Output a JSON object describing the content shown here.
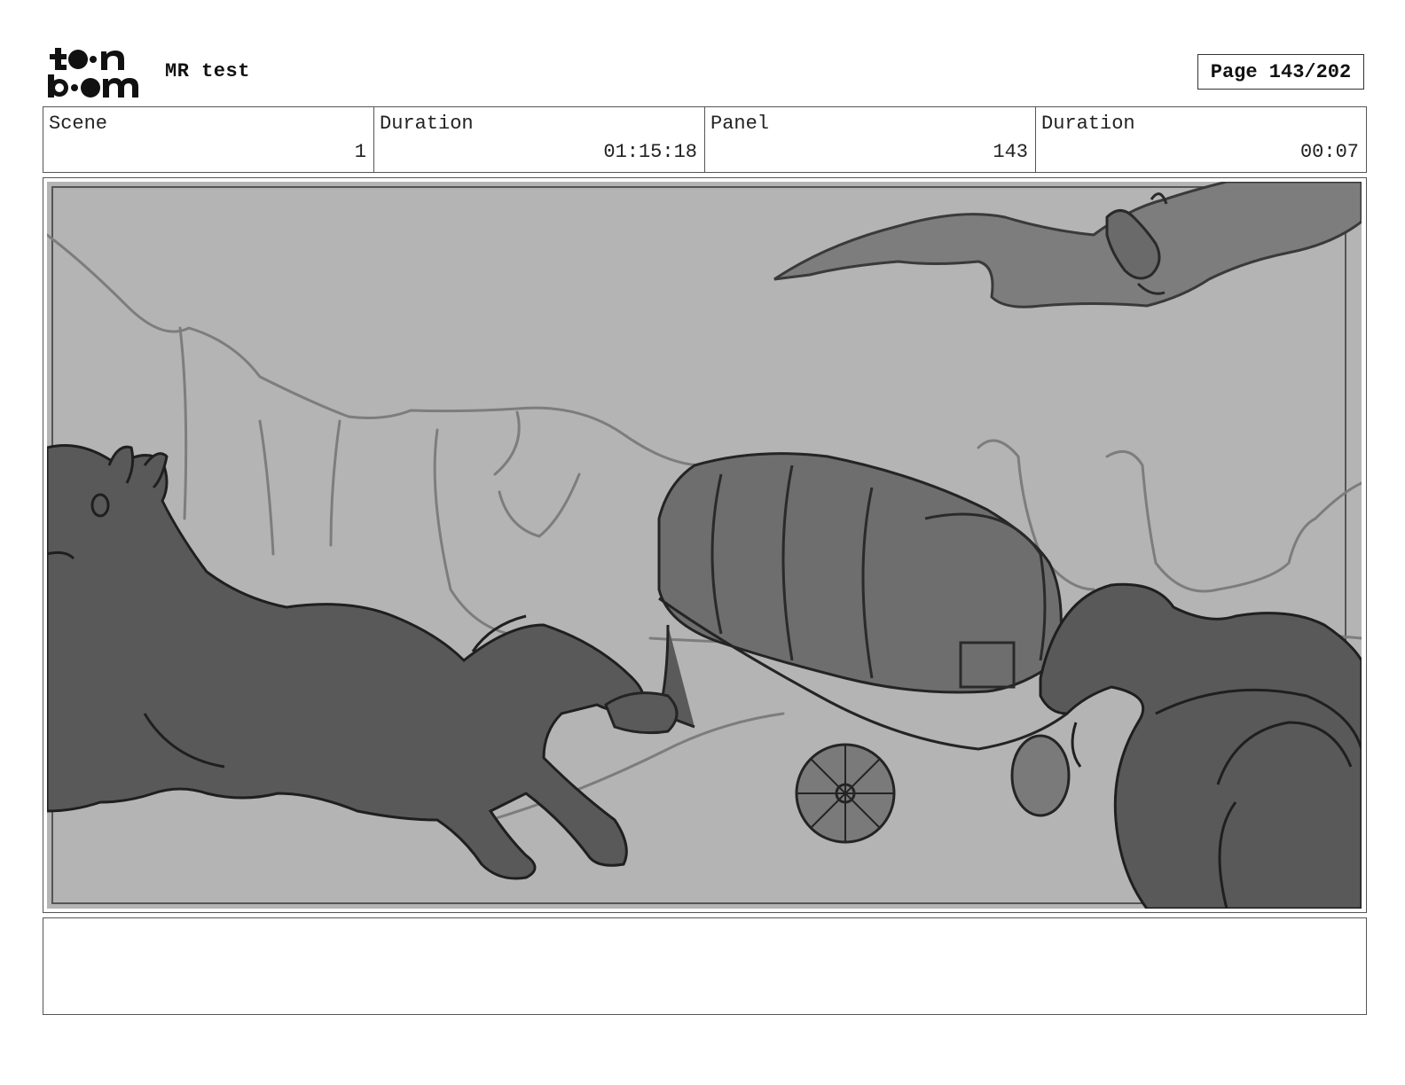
{
  "header": {
    "logo_name": "toonboom-logo",
    "title": "MR test",
    "page_label": "Page 143/202"
  },
  "info": {
    "scene_label": "Scene",
    "scene_value": "1",
    "scene_duration_label": "Duration",
    "scene_duration_value": "01:15:18",
    "panel_label": "Panel",
    "panel_value": "143",
    "panel_duration_label": "Duration",
    "panel_duration_value": "00:07"
  },
  "panel": {
    "image_description_icons": [
      "horse-sketch",
      "wagon-sketch",
      "flying-creature-sketch",
      "canyon-sketch"
    ],
    "colors": {
      "sky": "#b4b4b4",
      "ground": "#b9b9b9",
      "dark_fill": "#5a5a5a",
      "mid_fill": "#6e6e6e",
      "line": "#2a2a2a",
      "sketch_line": "#7d7d7d"
    }
  },
  "notes": {
    "text": ""
  }
}
